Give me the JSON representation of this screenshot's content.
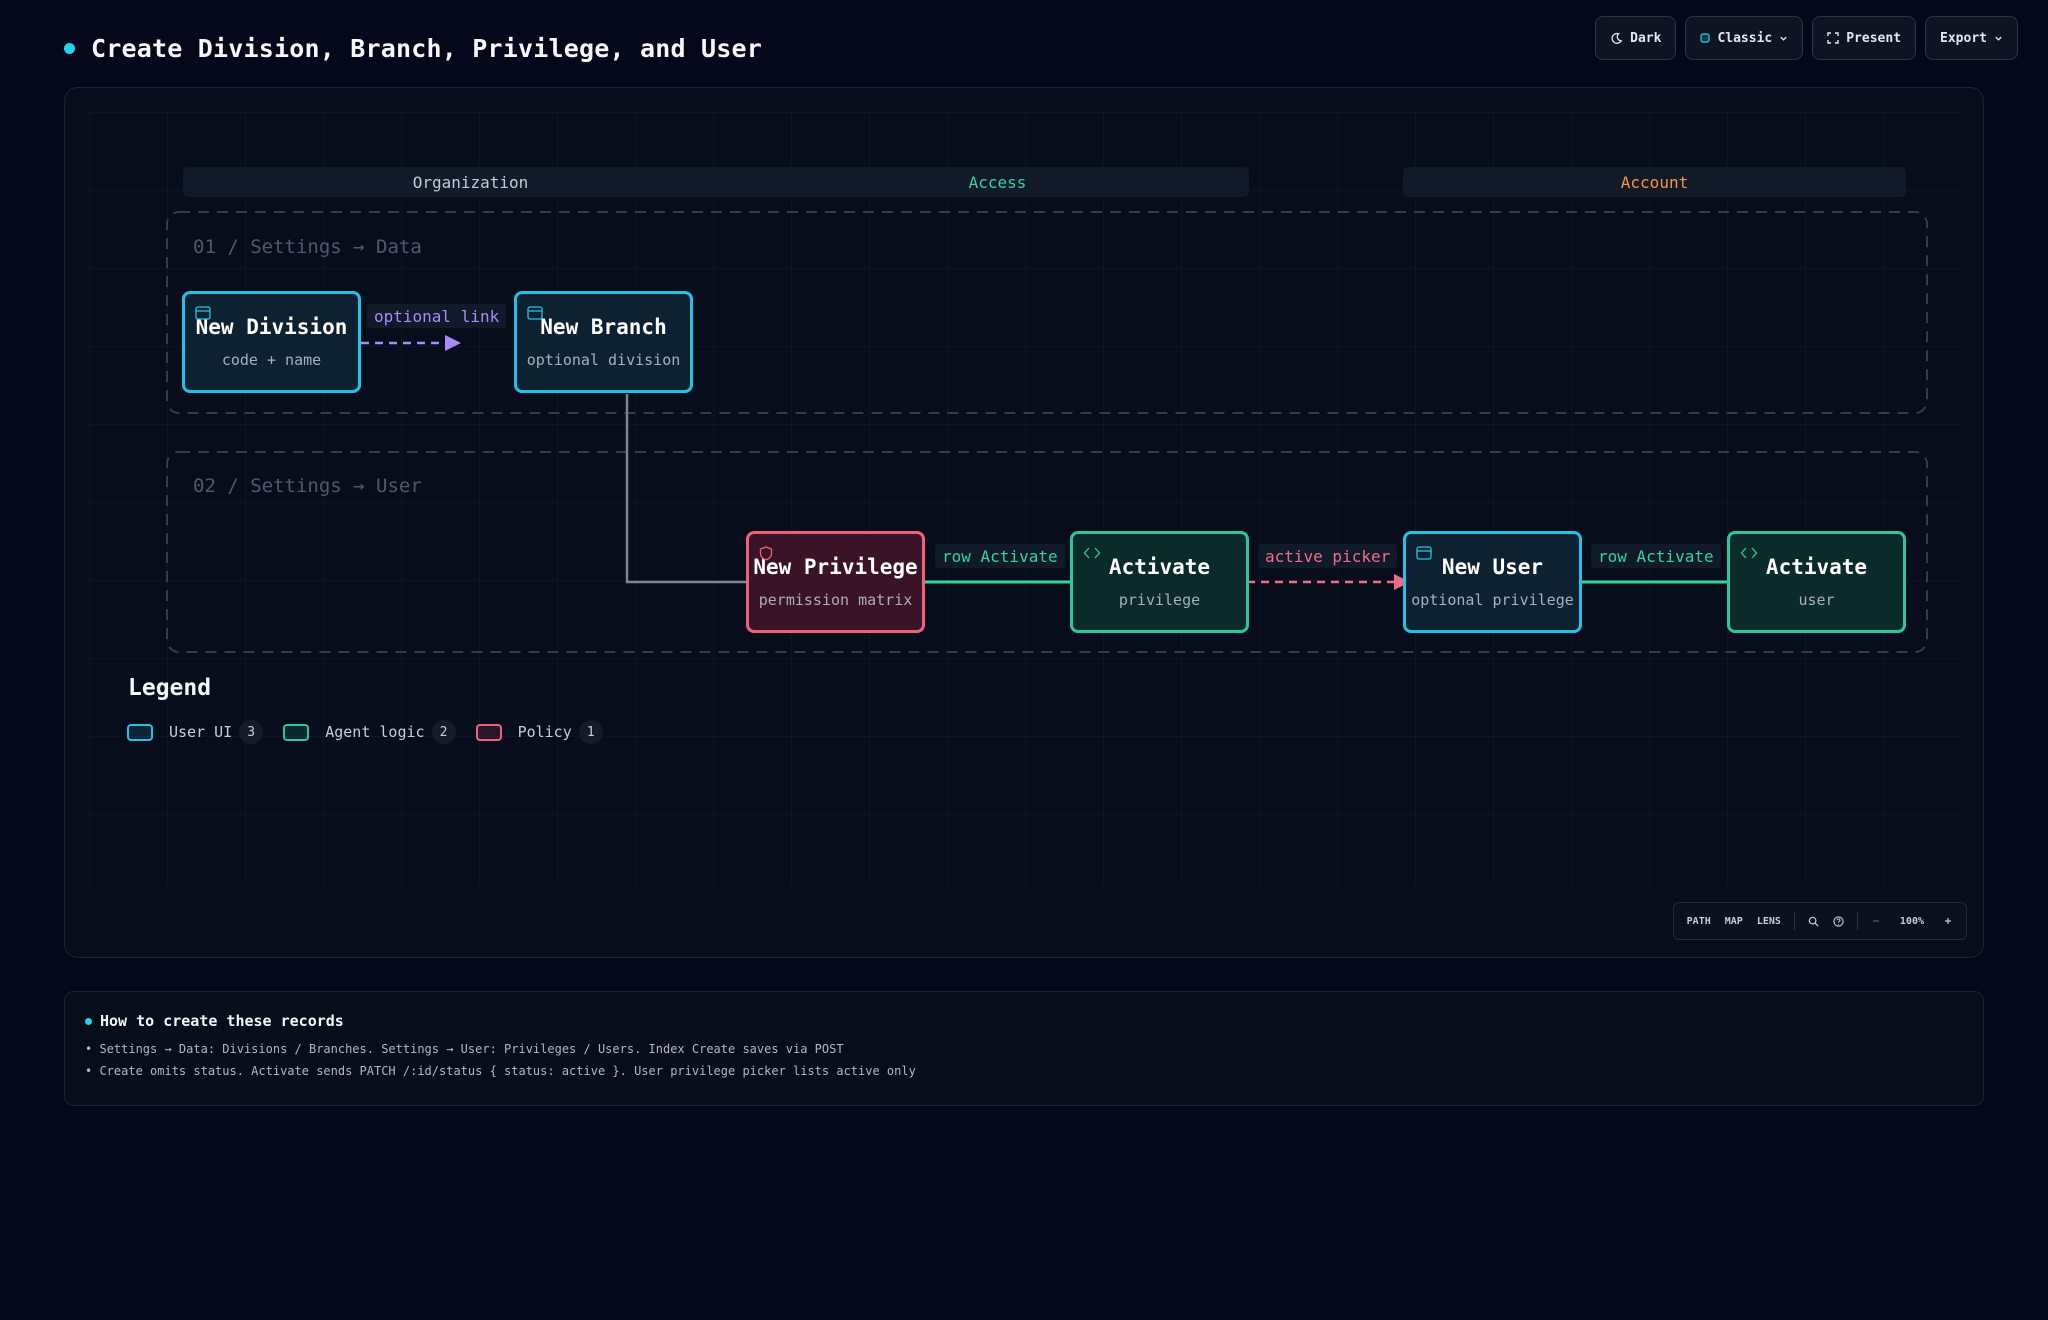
{
  "page": {
    "title": "Create Division, Branch, Privilege, and User"
  },
  "toolbar": {
    "theme_label": "Dark",
    "style_label": "Classic",
    "present_label": "Present",
    "export_label": "Export"
  },
  "diagram": {
    "lanes": [
      {
        "label": "Organization",
        "color": "#c3cad6"
      },
      {
        "label": "Access",
        "color": "#34d399"
      },
      {
        "label": "Account",
        "color": "#fb923c"
      }
    ],
    "stages": [
      {
        "label": "01 / Settings → Data"
      },
      {
        "label": "02 / Settings → User"
      }
    ],
    "nodes": [
      {
        "id": "new-division",
        "title": "New Division",
        "subtitle": "code + name",
        "kind": "user-ui",
        "icon": "window-icon"
      },
      {
        "id": "new-branch",
        "title": "New Branch",
        "subtitle": "optional division",
        "kind": "user-ui",
        "icon": "window-icon"
      },
      {
        "id": "new-privilege",
        "title": "New Privilege",
        "subtitle": "permission matrix",
        "kind": "policy",
        "icon": "shield-icon"
      },
      {
        "id": "activate-privilege",
        "title": "Activate",
        "subtitle": "privilege",
        "kind": "agent-logic",
        "icon": "code-icon"
      },
      {
        "id": "new-user",
        "title": "New User",
        "subtitle": "optional privilege",
        "kind": "user-ui",
        "icon": "window-icon"
      },
      {
        "id": "activate-user",
        "title": "Activate",
        "subtitle": "user",
        "kind": "agent-logic",
        "icon": "code-icon"
      }
    ],
    "edges": [
      {
        "from": "new-division",
        "to": "new-branch",
        "label": "optional link",
        "style": "dashed",
        "color": "#a78bfa"
      },
      {
        "from": "new-branch",
        "to": "new-privilege",
        "label": "",
        "style": "solid",
        "color": "#7b8596"
      },
      {
        "from": "new-privilege",
        "to": "activate-privilege",
        "label": "row Activate",
        "style": "solid",
        "color": "#34d399"
      },
      {
        "from": "activate-privilege",
        "to": "new-user",
        "label": "active picker",
        "style": "dashed",
        "color": "#f26b86"
      },
      {
        "from": "new-user",
        "to": "activate-user",
        "label": "row Activate",
        "style": "solid",
        "color": "#34d399"
      }
    ]
  },
  "legend": {
    "title": "Legend",
    "items": [
      {
        "label": "User UI",
        "count": "3",
        "color": "#22c2e6"
      },
      {
        "label": "Agent logic",
        "count": "2",
        "color": "#2bc79a"
      },
      {
        "label": "Policy",
        "count": "1",
        "color": "#f0607a"
      }
    ]
  },
  "canvas_toolbar": {
    "path_label": "PATH",
    "map_label": "MAP",
    "lens_label": "LENS",
    "zoom_label": "100%"
  },
  "notes": {
    "title": "How to create these records",
    "lines": [
      "• Settings → Data: Divisions / Branches. Settings → User: Privileges / Users. Index Create saves via POST",
      "• Create omits status. Activate sends PATCH /:id/status { status: active }. User privilege picker lists active only"
    ]
  }
}
